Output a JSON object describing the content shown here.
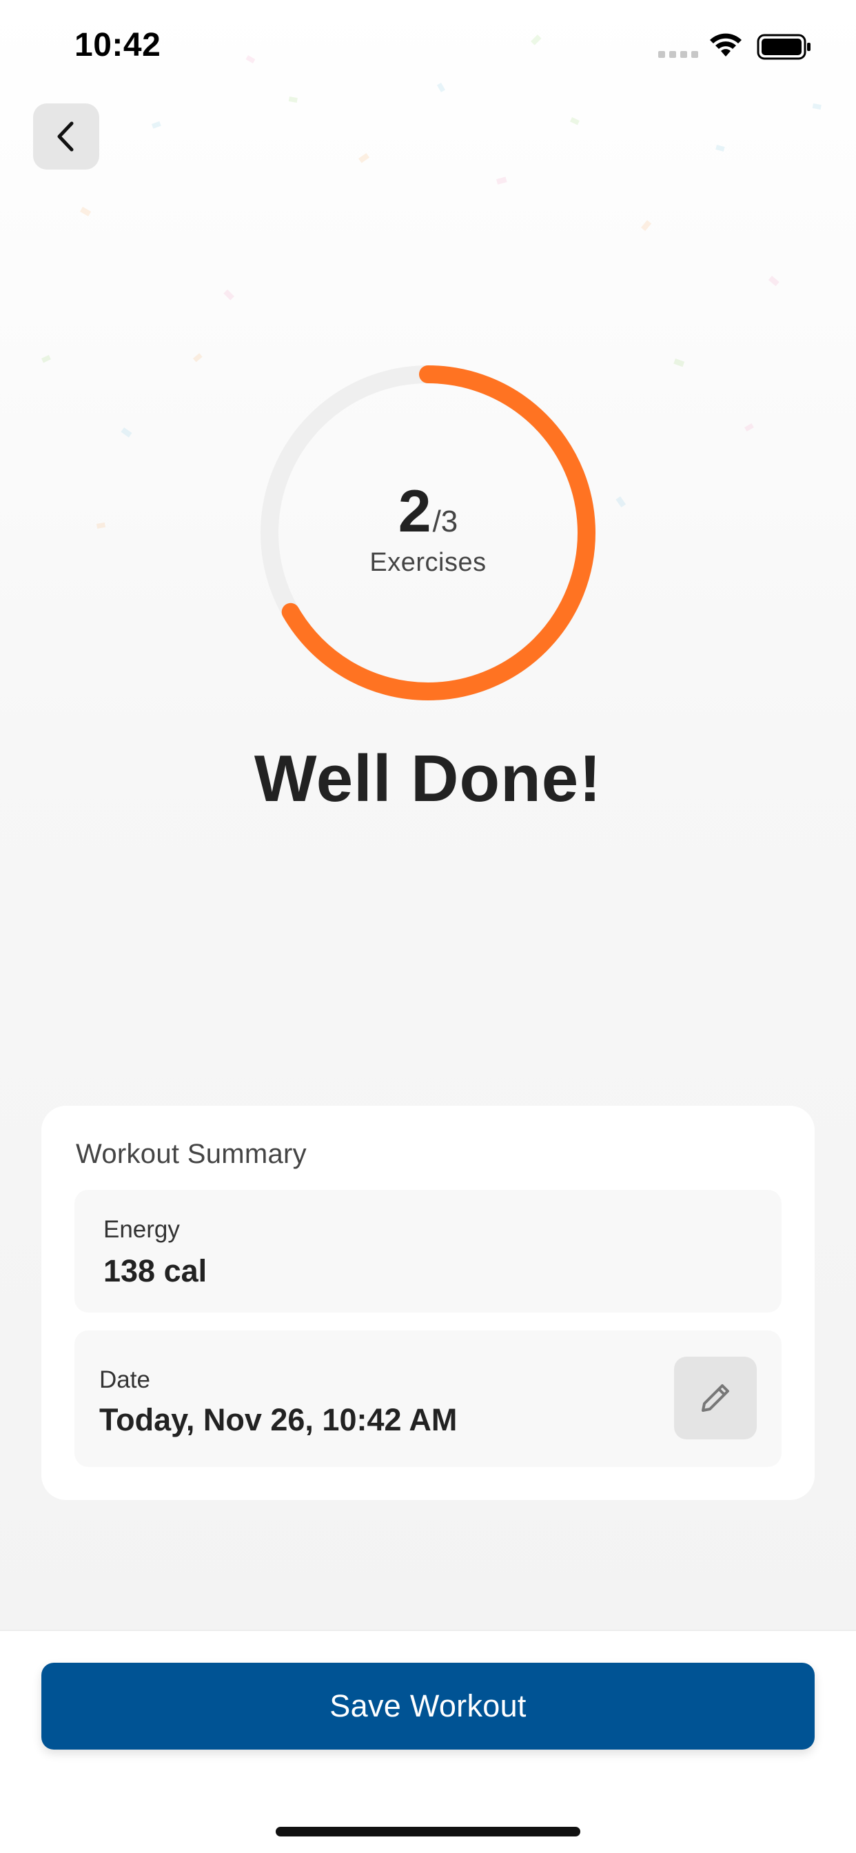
{
  "status_bar": {
    "time": "10:42"
  },
  "progress": {
    "completed": "2",
    "total": "/3",
    "label": "Exercises",
    "fraction": 0.6667,
    "color": "#FF7322",
    "track_color": "#EFEFEF"
  },
  "headline": "Well Done!",
  "summary": {
    "title": "Workout Summary",
    "energy": {
      "label": "Energy",
      "value": "138 cal"
    },
    "date": {
      "label": "Date",
      "value": "Today, Nov 26, 10:42 AM"
    }
  },
  "actions": {
    "save_label": "Save Workout",
    "save_color": "#005394"
  },
  "icons": {
    "back": "chevron-left-icon",
    "edit": "pencil-icon",
    "wifi": "wifi-icon",
    "battery": "battery-icon",
    "signal": "cellular-signal-icon"
  }
}
